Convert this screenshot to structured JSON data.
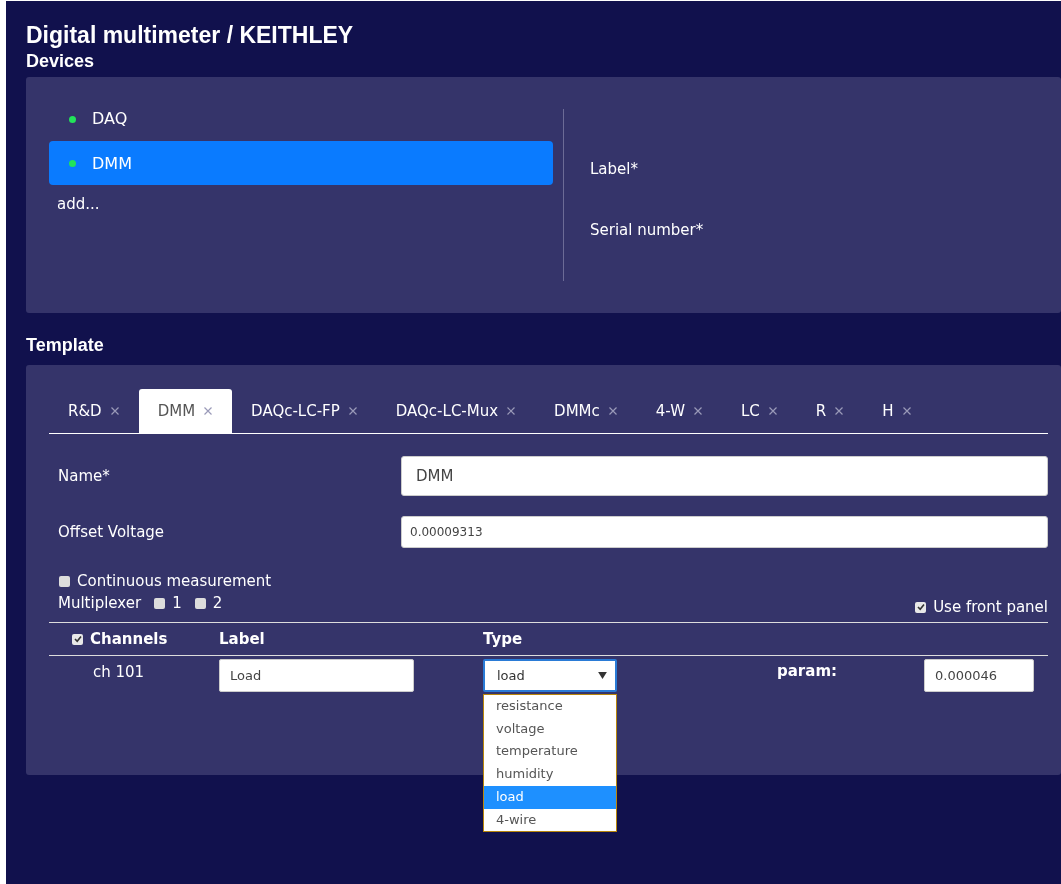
{
  "title": "Digital multimeter / KEITHLEY",
  "devices": {
    "heading": "Devices",
    "items": [
      {
        "label": "DAQ",
        "selected": false,
        "color": "#22e35a"
      },
      {
        "label": "DMM",
        "selected": true,
        "color": "#22e35a"
      }
    ],
    "add_link": "add...",
    "form_labels": [
      "Label*",
      "Serial number*"
    ]
  },
  "template": {
    "heading": "Template",
    "tabs": [
      {
        "label": "R&D",
        "selected": false
      },
      {
        "label": "DMM",
        "selected": true
      },
      {
        "label": "DAQc-LC-FP",
        "selected": false
      },
      {
        "label": "DAQc-LC-Mux",
        "selected": false
      },
      {
        "label": "DMMc",
        "selected": false
      },
      {
        "label": "4-W",
        "selected": false
      },
      {
        "label": "LC",
        "selected": false
      },
      {
        "label": "R",
        "selected": false
      },
      {
        "label": "H",
        "selected": false
      }
    ],
    "name": {
      "label": "Name*",
      "value": "DMM"
    },
    "offset_voltage": {
      "label": "Offset Voltage",
      "value": "0.00009313"
    },
    "continuous_measurement": {
      "label": "Continuous measurement",
      "checked": false
    },
    "multiplexer": {
      "label": "Multiplexer",
      "options": [
        {
          "label": "1",
          "checked": false
        },
        {
          "label": "2",
          "checked": false
        }
      ]
    },
    "use_front_panel": {
      "label": "Use front panel",
      "checked": true
    },
    "channels": {
      "header": {
        "label": "Channels",
        "checked": true
      },
      "columns": [
        "Label",
        "Type"
      ],
      "rows": [
        {
          "channel": "ch 101",
          "label": "Load",
          "type": "load",
          "param_label": "param:",
          "param": "0.000046"
        }
      ]
    },
    "type_dropdown": {
      "expanded": true,
      "options": [
        {
          "label": "resistance",
          "selected": false
        },
        {
          "label": "voltage",
          "selected": false
        },
        {
          "label": "temperature",
          "selected": false
        },
        {
          "label": "humidity",
          "selected": false
        },
        {
          "label": "load",
          "selected": true
        },
        {
          "label": "4-wire",
          "selected": false
        }
      ]
    }
  }
}
